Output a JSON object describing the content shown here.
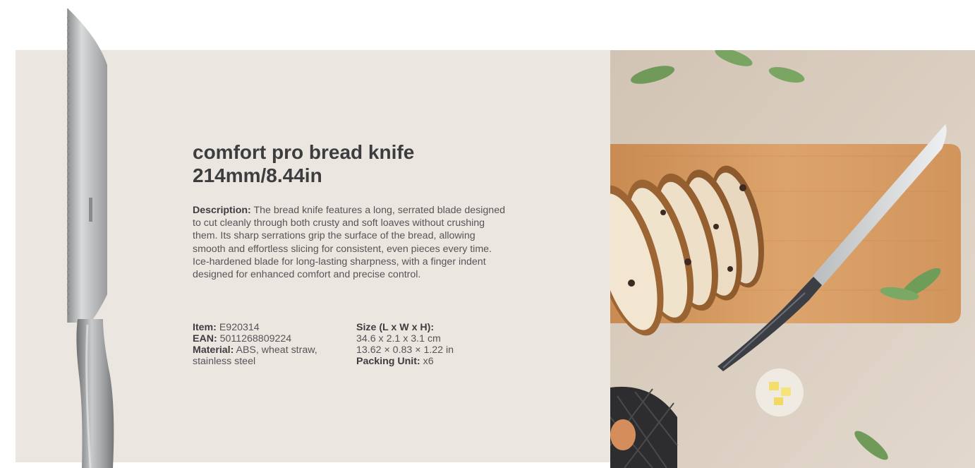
{
  "product": {
    "title_line1": "comfort pro bread knife",
    "title_line2": "214mm/8.44in",
    "description_label": "Description:",
    "description_text": " The bread knife features a long, serrated blade designed to cut cleanly through both crusty and soft loaves without crushing them. Its sharp serrations grip the surface of the bread, allowing smooth and effortless slicing for consistent, even pieces every time. Ice-hardened blade for long-lasting sharpness, with a finger indent designed for enhanced comfort and precise control."
  },
  "specs": {
    "item_label": "Item:",
    "item_value": " E920314",
    "ean_label": "EAN:",
    "ean_value": " 5011268809224",
    "material_label": "Material:",
    "material_value": " ABS, wheat straw,",
    "material_value_2": "stainless steel",
    "size_label": "Size (L x W x H):",
    "size_cm": "34.6 x 2.1 x 3.1 cm",
    "size_in": "13.62 × 0.83 × 1.22 in",
    "packing_label": "Packing Unit:",
    "packing_value": " x6"
  },
  "colors": {
    "panel_background": "#ece6e0",
    "text_dark": "#3d3d40",
    "text_body": "#555558",
    "wood": "#d8a06a",
    "table": "#d9cdbf"
  },
  "images": {
    "product_image": "serrated-bread-knife",
    "lifestyle_photo": "bread-slices-on-cutting-board-with-knife"
  }
}
